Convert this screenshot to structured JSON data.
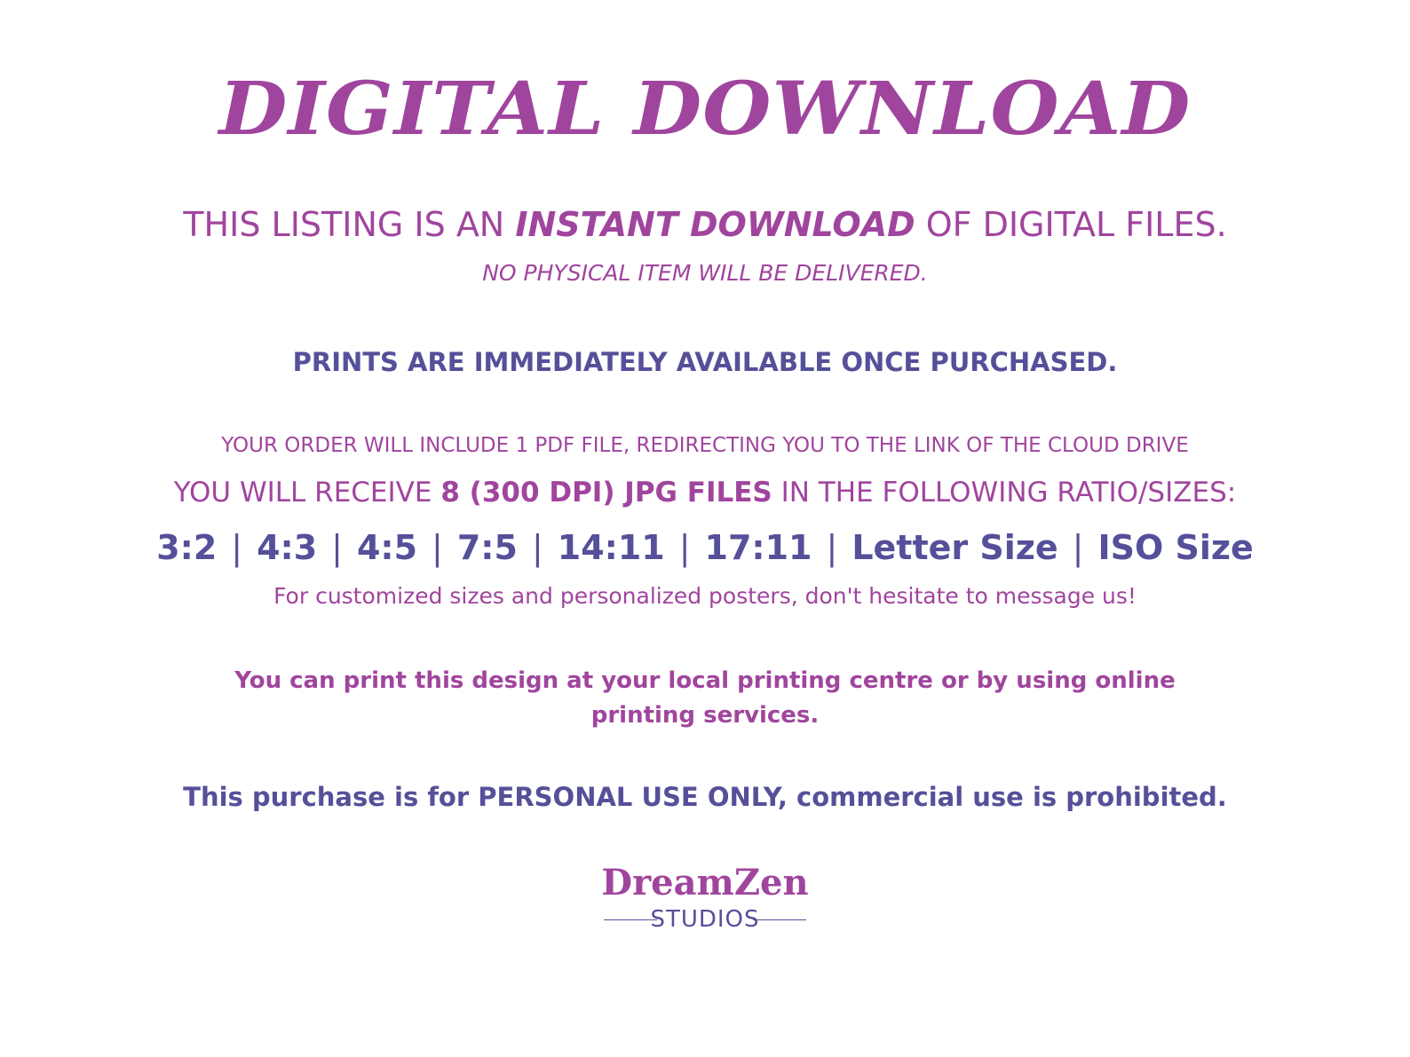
{
  "title": "DIGITAL DOWNLOAD",
  "instant": {
    "prefix": "THIS LISTING IS AN ",
    "emphasis": "INSTANT DOWNLOAD",
    "suffix": " OF DIGITAL FILES."
  },
  "no_physical": "NO PHYSICAL ITEM WILL BE DELIVERED.",
  "prints_available": "PRINTS ARE IMMEDIATELY AVAILABLE ONCE PURCHASED.",
  "order_include": "YOUR ORDER WILL INCLUDE 1 PDF FILE, REDIRECTING YOU TO THE LINK OF THE CLOUD DRIVE",
  "receive": {
    "prefix": "YOU WILL RECEIVE ",
    "emphasis": "8 (300 DPI) JPG FILES",
    "suffix": " IN THE FOLLOWING RATIO/SIZES:"
  },
  "sizes": [
    "3:2",
    "4:3",
    "4:5",
    "7:5",
    "14:11",
    "17:11",
    "Letter Size",
    "ISO Size"
  ],
  "separator": "|",
  "customized": "For customized sizes and personalized posters, don't hesitate to message us!",
  "print_design": "You can print this design at your local printing centre or by using online printing services.",
  "personal_use": "This purchase is for PERSONAL USE ONLY, commercial use is prohibited.",
  "logo": {
    "name": "DreamZen",
    "sub": "STUDIOS"
  },
  "colors": {
    "magenta": "#a0459e",
    "indigo": "#555099",
    "background": "#ffffff"
  }
}
